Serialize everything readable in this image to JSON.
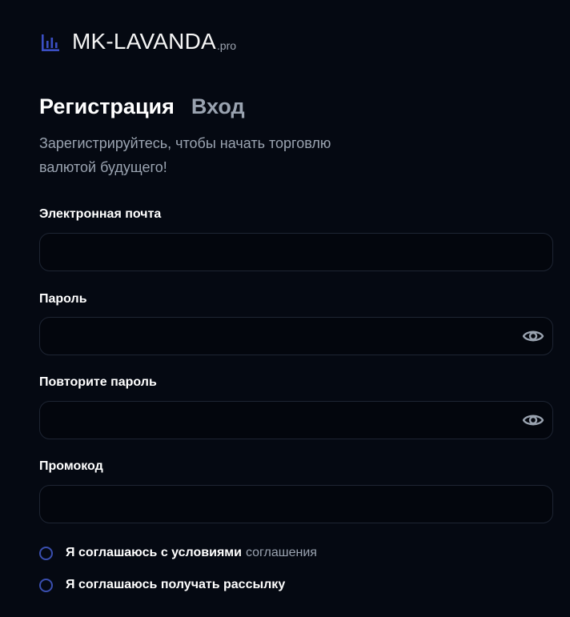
{
  "brand": {
    "name": "MK-LAVANDA",
    "suffix": ".pro",
    "icon": "bar-chart-icon",
    "accent_color": "#3b4fc4"
  },
  "tabs": {
    "register": "Регистрация",
    "login": "Вход"
  },
  "subtitle": "Зарегистрируйтесь, чтобы начать торговлю валютой будущего!",
  "form": {
    "email": {
      "label": "Электронная почта",
      "value": "",
      "placeholder": ""
    },
    "password": {
      "label": "Пароль",
      "value": "",
      "placeholder": "",
      "toggle_icon": "eye-icon"
    },
    "repeat_password": {
      "label": "Повторите пароль",
      "value": "",
      "placeholder": "",
      "toggle_icon": "eye-icon"
    },
    "promo": {
      "label": "Промокод",
      "value": "",
      "placeholder": ""
    }
  },
  "agreements": {
    "terms_text": "Я соглашаюсь с условиями",
    "terms_link": "соглашения",
    "newsletter_text": "Я соглашаюсь получать рассылку"
  },
  "colors": {
    "background": "#050912",
    "text_primary": "#ffffff",
    "text_muted": "#9aa3b0",
    "border": "#1e2533",
    "radio_border": "#3a4fb0"
  }
}
